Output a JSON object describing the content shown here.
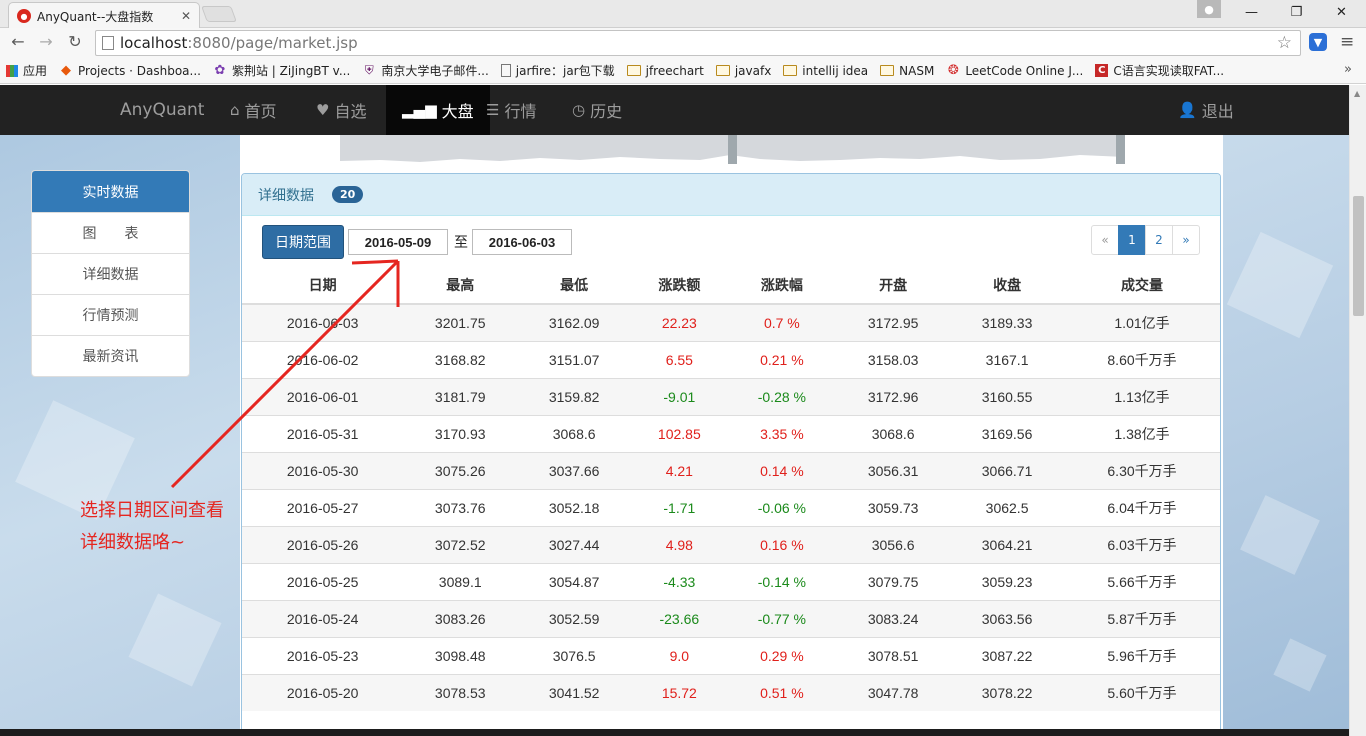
{
  "browser": {
    "tab_title": "AnyQuant--大盘指数",
    "url_host": "localhost",
    "url_rest": ":8080/page/market.jsp",
    "bookmarks": [
      {
        "label": "应用",
        "icon": "apps-icon"
      },
      {
        "label": "Projects · Dashboa...",
        "icon": "gitlab-icon"
      },
      {
        "label": "紫荆站 | ZiJingBT v...",
        "icon": "zijing-icon"
      },
      {
        "label": "南京大学电子邮件...",
        "icon": "nju-icon"
      },
      {
        "label": "jarfire：jar包下载",
        "icon": "page-icon"
      },
      {
        "label": "jfreechart",
        "icon": "folder-icon"
      },
      {
        "label": "javafx",
        "icon": "folder-icon"
      },
      {
        "label": "intellij idea",
        "icon": "folder-icon"
      },
      {
        "label": "NASM",
        "icon": "folder-icon"
      },
      {
        "label": "LeetCode Online J...",
        "icon": "leetcode-icon"
      },
      {
        "label": "C语言实现读取FAT...",
        "icon": "csdn-icon"
      }
    ]
  },
  "nav": {
    "brand": "AnyQuant",
    "items": [
      {
        "label": "首页",
        "icon": "home-icon"
      },
      {
        "label": "自选",
        "icon": "heart-icon"
      },
      {
        "label": "大盘",
        "icon": "signal-icon",
        "active": true
      },
      {
        "label": "行情",
        "icon": "list-icon"
      },
      {
        "label": "历史",
        "icon": "clock-icon"
      }
    ],
    "logout": "退出"
  },
  "sidebar": {
    "items": [
      {
        "label": "实时数据",
        "active": true
      },
      {
        "label": "图　　表"
      },
      {
        "label": "详细数据"
      },
      {
        "label": "行情预测"
      },
      {
        "label": "最新资讯"
      }
    ]
  },
  "annotation": {
    "line1": "选择日期区间查看",
    "line2": "详细数据咯~",
    "color": "#e52620"
  },
  "panel": {
    "title": "详细数据",
    "badge": "20",
    "range_button": "日期范围",
    "start_date": "2016-05-09",
    "to_label": "至",
    "end_date": "2016-06-03",
    "pager": [
      "«",
      "1",
      "2",
      "»"
    ],
    "active_page": "1"
  },
  "table": {
    "headers": [
      "日期",
      "最高",
      "最低",
      "涨跌额",
      "涨跌幅",
      "开盘",
      "收盘",
      "成交量"
    ],
    "rows": [
      {
        "date": "2016-06-03",
        "high": "3201.75",
        "low": "3162.09",
        "change": "22.23",
        "pct": "0.7 %",
        "open": "3172.95",
        "close": "3189.33",
        "volume": "1.01亿手",
        "trend": "up"
      },
      {
        "date": "2016-06-02",
        "high": "3168.82",
        "low": "3151.07",
        "change": "6.55",
        "pct": "0.21 %",
        "open": "3158.03",
        "close": "3167.1",
        "volume": "8.60千万手",
        "trend": "up"
      },
      {
        "date": "2016-06-01",
        "high": "3181.79",
        "low": "3159.82",
        "change": "-9.01",
        "pct": "-0.28 %",
        "open": "3172.96",
        "close": "3160.55",
        "volume": "1.13亿手",
        "trend": "down"
      },
      {
        "date": "2016-05-31",
        "high": "3170.93",
        "low": "3068.6",
        "change": "102.85",
        "pct": "3.35 %",
        "open": "3068.6",
        "close": "3169.56",
        "volume": "1.38亿手",
        "trend": "up"
      },
      {
        "date": "2016-05-30",
        "high": "3075.26",
        "low": "3037.66",
        "change": "4.21",
        "pct": "0.14 %",
        "open": "3056.31",
        "close": "3066.71",
        "volume": "6.30千万手",
        "trend": "up"
      },
      {
        "date": "2016-05-27",
        "high": "3073.76",
        "low": "3052.18",
        "change": "-1.71",
        "pct": "-0.06 %",
        "open": "3059.73",
        "close": "3062.5",
        "volume": "6.04千万手",
        "trend": "down"
      },
      {
        "date": "2016-05-26",
        "high": "3072.52",
        "low": "3027.44",
        "change": "4.98",
        "pct": "0.16 %",
        "open": "3056.6",
        "close": "3064.21",
        "volume": "6.03千万手",
        "trend": "up"
      },
      {
        "date": "2016-05-25",
        "high": "3089.1",
        "low": "3054.87",
        "change": "-4.33",
        "pct": "-0.14 %",
        "open": "3079.75",
        "close": "3059.23",
        "volume": "5.66千万手",
        "trend": "down"
      },
      {
        "date": "2016-05-24",
        "high": "3083.26",
        "low": "3052.59",
        "change": "-23.66",
        "pct": "-0.77 %",
        "open": "3083.24",
        "close": "3063.56",
        "volume": "5.87千万手",
        "trend": "down"
      },
      {
        "date": "2016-05-23",
        "high": "3098.48",
        "low": "3076.5",
        "change": "9.0",
        "pct": "0.29 %",
        "open": "3078.51",
        "close": "3087.22",
        "volume": "5.96千万手",
        "trend": "up"
      },
      {
        "date": "2016-05-20",
        "high": "3078.53",
        "low": "3041.52",
        "change": "15.72",
        "pct": "0.51 %",
        "open": "3047.78",
        "close": "3078.22",
        "volume": "5.60千万手",
        "trend": "up"
      }
    ]
  },
  "colors": {
    "up": "#e0201b",
    "down": "#1b8a1b",
    "primary": "#337ab7",
    "navbar": "#222222"
  }
}
